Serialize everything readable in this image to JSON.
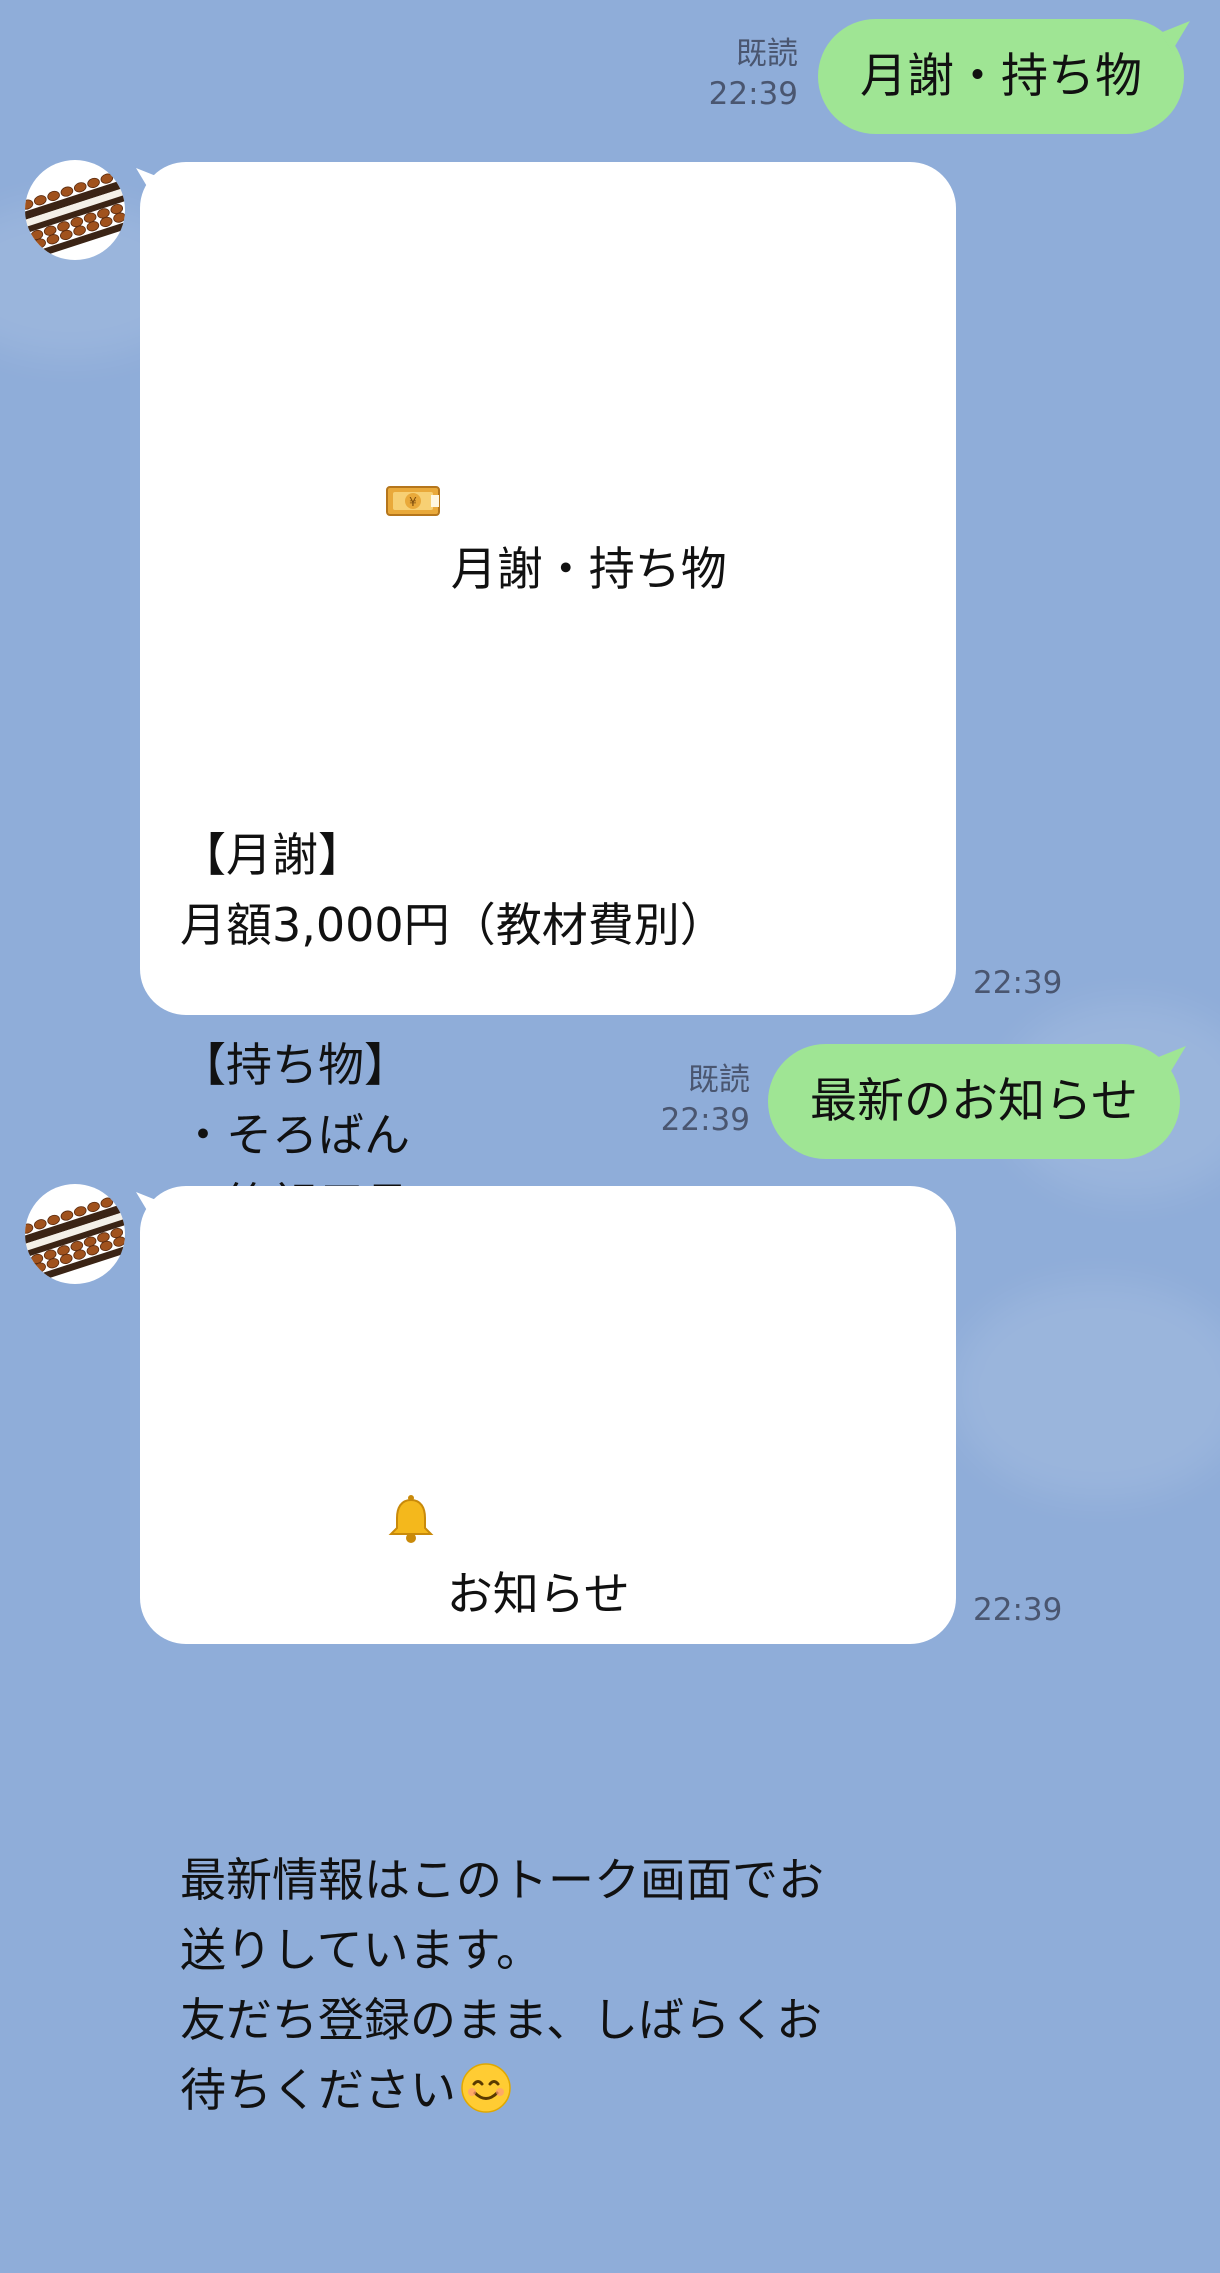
{
  "chat": {
    "messages": [
      {
        "id": "m1",
        "direction": "out",
        "text": "月謝・持ち物",
        "read_label": "既読",
        "time": "22:39"
      },
      {
        "id": "m2",
        "direction": "in",
        "icon": "money-icon",
        "title": "月謝・持ち物",
        "body": "【月謝】\n月額3,000円（教材費別）\n\n【持ち物】\n・そろばん\n・筆記用具\n・出席ノート\n\n詳細はお気軽にお問い合わせく\nださい！",
        "time": "22:39"
      },
      {
        "id": "m3",
        "direction": "out",
        "text": "最新のお知らせ",
        "read_label": "既読",
        "time": "22:39"
      },
      {
        "id": "m4",
        "direction": "in",
        "icon": "bell-icon",
        "title": "お知らせ",
        "body": "最新情報はこのトーク画面でお\n送りしています。\n友だち登録のまま、しばらくお\n待ちください",
        "trailing_emoji": "smiling-face-icon",
        "time": "22:39"
      }
    ]
  },
  "colors": {
    "background": "#8fadd9",
    "outgoing_bubble": "#9fe594",
    "incoming_bubble": "#ffffff"
  }
}
